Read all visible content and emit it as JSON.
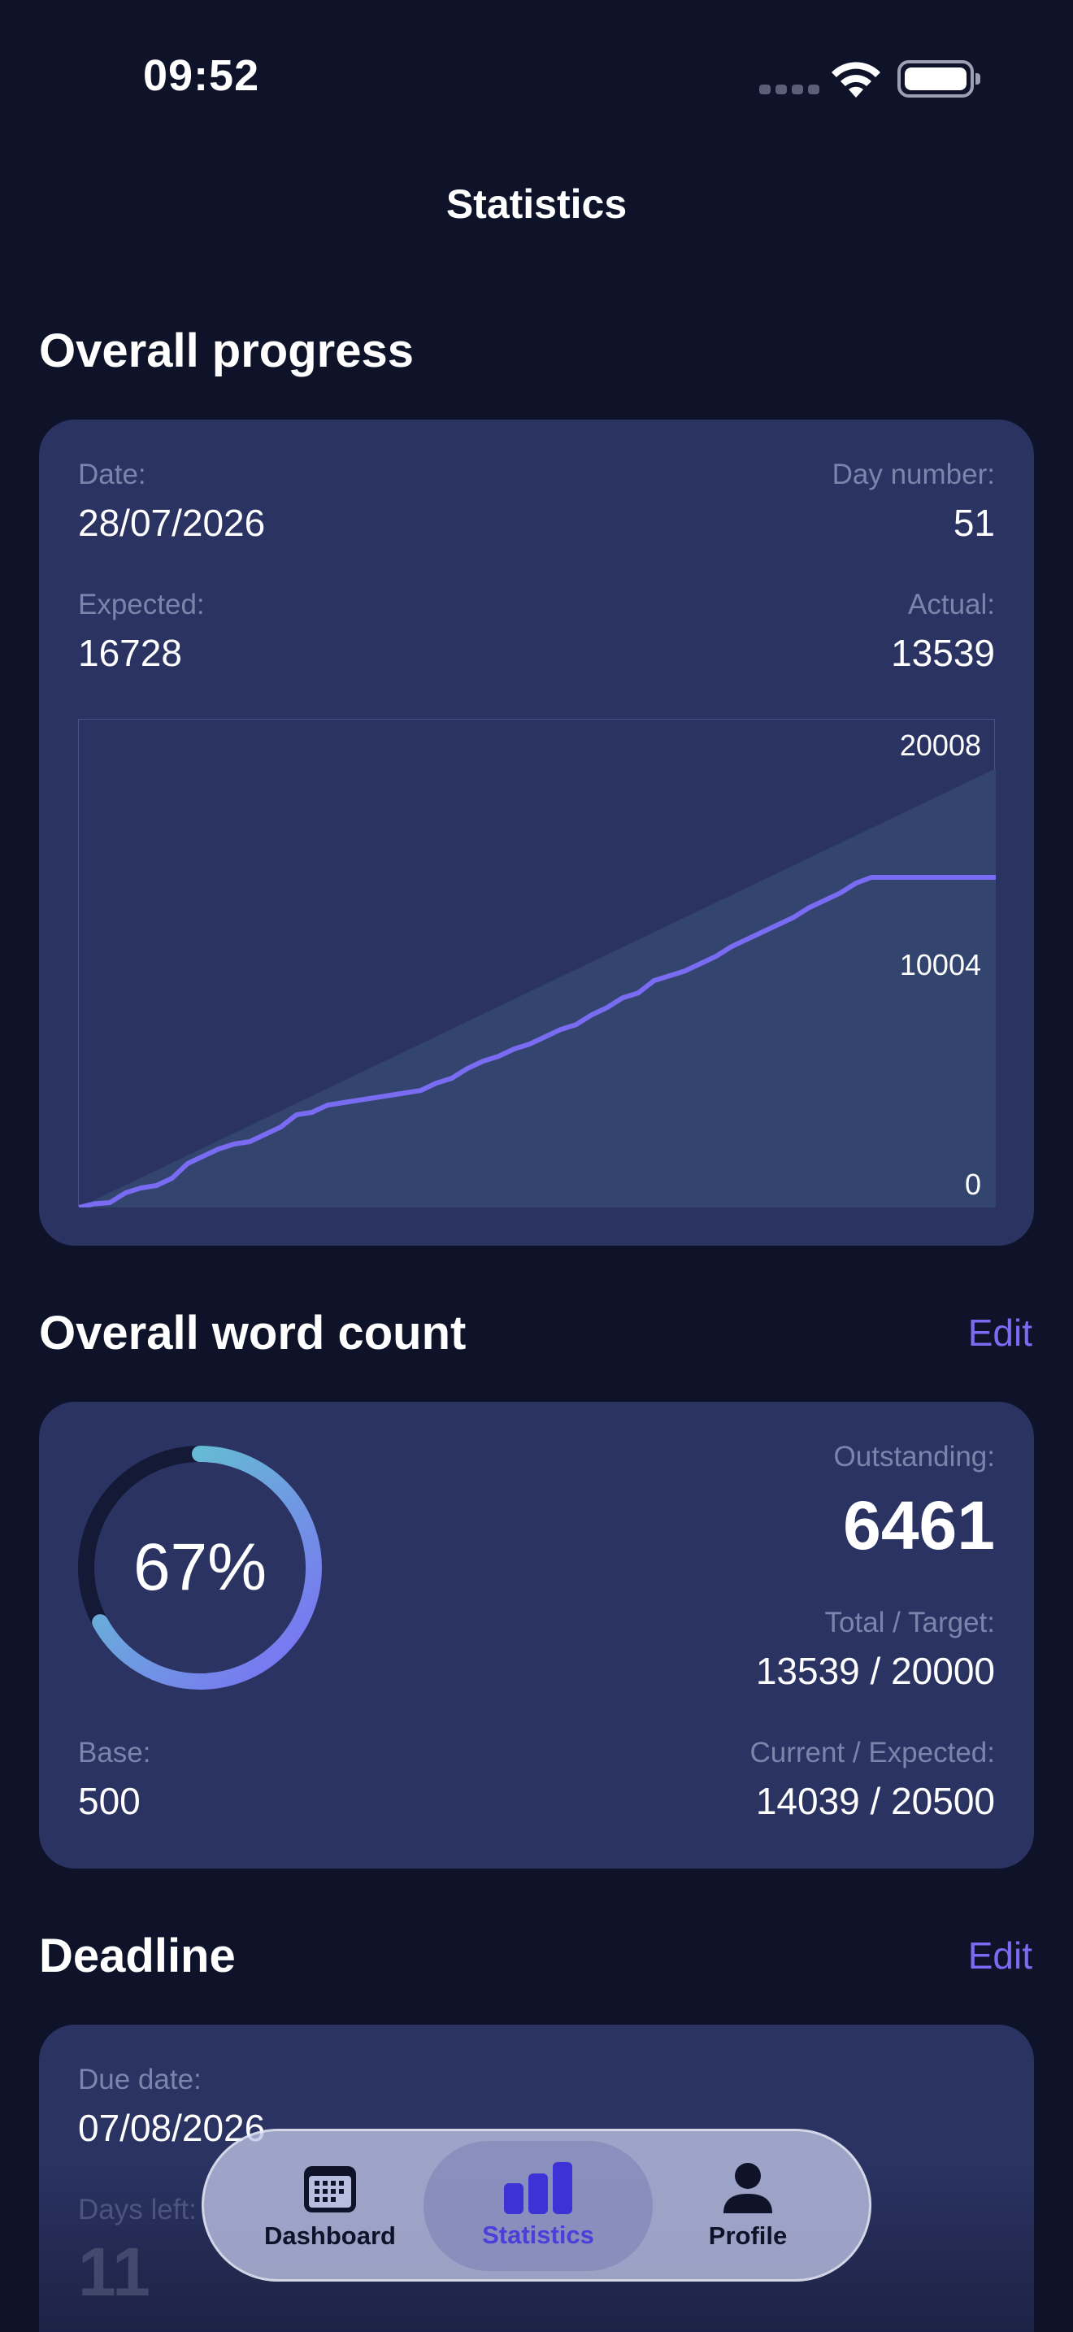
{
  "status_bar": {
    "time": "09:52"
  },
  "nav": {
    "title": "Statistics"
  },
  "overall_progress": {
    "section_title": "Overall progress",
    "date_label": "Date:",
    "date_value": "28/07/2026",
    "day_label": "Day number:",
    "day_value": "51",
    "expected_label": "Expected:",
    "expected_value": "16728",
    "actual_label": "Actual:",
    "actual_value": "13539",
    "chart_data": {
      "type": "line",
      "ylim": [
        0,
        20008
      ],
      "y_ticks": [
        "20008",
        "10004",
        "0"
      ],
      "expected_series": {
        "x": [
          1,
          60
        ],
        "values": [
          0,
          18000
        ]
      },
      "actual_series": {
        "x": [
          1,
          2,
          3,
          4,
          5,
          6,
          7,
          8,
          9,
          10,
          11,
          12,
          13,
          14,
          15,
          16,
          17,
          18,
          19,
          20,
          21,
          22,
          23,
          24,
          25,
          26,
          27,
          28,
          29,
          30,
          31,
          32,
          33,
          34,
          35,
          36,
          37,
          38,
          39,
          40,
          41,
          42,
          43,
          44,
          45,
          46,
          47,
          48,
          49,
          50,
          51,
          52,
          53,
          54,
          55,
          56,
          57,
          58,
          59,
          60
        ],
        "values": [
          0,
          150,
          200,
          600,
          800,
          900,
          1200,
          1800,
          2100,
          2400,
          2600,
          2700,
          3000,
          3300,
          3800,
          3900,
          4200,
          4300,
          4400,
          4500,
          4600,
          4700,
          4800,
          5100,
          5300,
          5700,
          6000,
          6200,
          6500,
          6700,
          7000,
          7300,
          7500,
          7900,
          8200,
          8600,
          8800,
          9300,
          9500,
          9700,
          10000,
          10300,
          10700,
          11000,
          11300,
          11600,
          11900,
          12300,
          12600,
          12900,
          13300,
          13539,
          13539,
          13539,
          13539,
          13539,
          13539,
          13539,
          13539,
          13539
        ]
      }
    }
  },
  "word_count": {
    "section_title": "Overall word count",
    "edit_label": "Edit",
    "percent_value": 67,
    "percent_text": "67%",
    "outstanding_label": "Outstanding:",
    "outstanding_value": "6461",
    "total_label": "Total / Target:",
    "total_value": "13539 / 20000",
    "base_label": "Base:",
    "base_value": "500",
    "current_label": "Current / Expected:",
    "current_value": "14039 / 20500"
  },
  "deadline": {
    "section_title": "Deadline",
    "edit_label": "Edit",
    "due_label": "Due date:",
    "due_value": "07/08/2026",
    "days_left_label": "Days left:",
    "days_left_value": "11"
  },
  "tab_bar": {
    "tabs": [
      {
        "label": "Dashboard",
        "icon": "calendar-icon"
      },
      {
        "label": "Statistics",
        "icon": "bar-chart-icon",
        "active": true
      },
      {
        "label": "Profile",
        "icon": "person-icon"
      }
    ]
  },
  "colors": {
    "background": "#0f1329",
    "card": "#2a3362",
    "accent": "#7a6cf2",
    "ring_start": "#7b6cf6",
    "ring_end": "#5fd3c9"
  }
}
